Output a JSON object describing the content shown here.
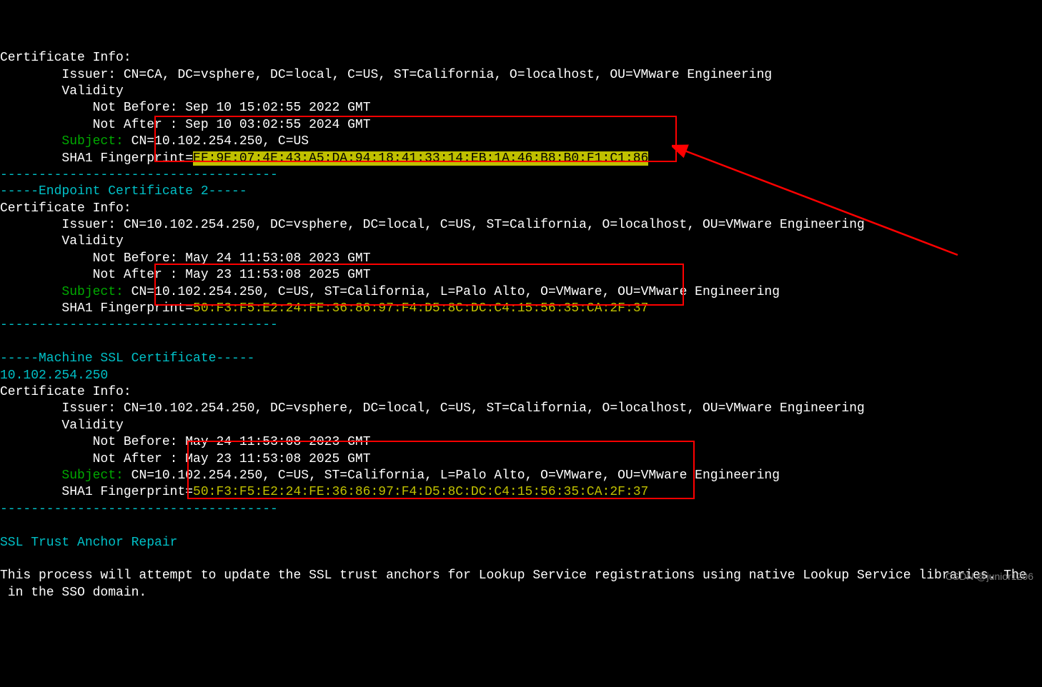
{
  "cert1": {
    "info": "Certificate Info:",
    "issuer": "CN=CA, DC=vsphere, DC=local, C=US, ST=California, O=localhost, OU=VMware Engineering",
    "validity_label": "Validity",
    "not_before": "Sep 10 15:02:55 2022 GMT",
    "not_after": "Sep 10 03:02:55 2024 GMT",
    "subject_label": "Subject:",
    "subject": "CN=10.102.254.250, C=US",
    "fingerprint": "EF:9E:07:4E:43:A5:DA:94:18:41:33:14:EB:1A:46:B8:B0:F1:C1:86"
  },
  "cert2": {
    "header": "-----Endpoint Certificate 2-----",
    "info": "Certificate Info:",
    "issuer": "CN=10.102.254.250, DC=vsphere, DC=local, C=US, ST=California, O=localhost, OU=VMware Engineering",
    "validity_label": "Validity",
    "not_before": "May 24 11:53:08 2023 GMT",
    "not_after": "May 23 11:53:08 2025 GMT",
    "subject_label": "Subject:",
    "subject": "CN=10.102.254.250, C=US, ST=California, L=Palo Alto, O=VMware, OU=VMware Engineering",
    "fingerprint": "50:F3:F5:E2:24:FE:36:86:97:F4:D5:8C:DC:C4:15:56:35:CA:2F:37"
  },
  "machine": {
    "header": "-----Machine SSL Certificate-----",
    "ip": "10.102.254.250",
    "info": "Certificate Info:",
    "issuer": "CN=10.102.254.250, DC=vsphere, DC=local, C=US, ST=California, O=localhost, OU=VMware Engineering",
    "validity_label": "Validity",
    "not_before": "May 24 11:53:08 2023 GMT",
    "not_after": "May 23 11:53:08 2025 GMT",
    "subject_label": "Subject:",
    "subject": "CN=10.102.254.250, C=US, ST=California, L=Palo Alto, O=VMware, OU=VMware Engineering",
    "fingerprint": "50:F3:F5:E2:24:FE:36:86:97:F4:D5:8C:DC:C4:15:56:35:CA:2F:37"
  },
  "dashes": {
    "line1": "------------------------------------",
    "line2": "------------------------------------",
    "line3": "------------------------------------"
  },
  "repair": {
    "header": "SSL Trust Anchor Repair",
    "text": "This process will attempt to update the SSL trust anchors for Lookup Service registrations using native Lookup Service libraries. The\n in the SSO domain."
  },
  "watermark": "CSDN @junior1206"
}
